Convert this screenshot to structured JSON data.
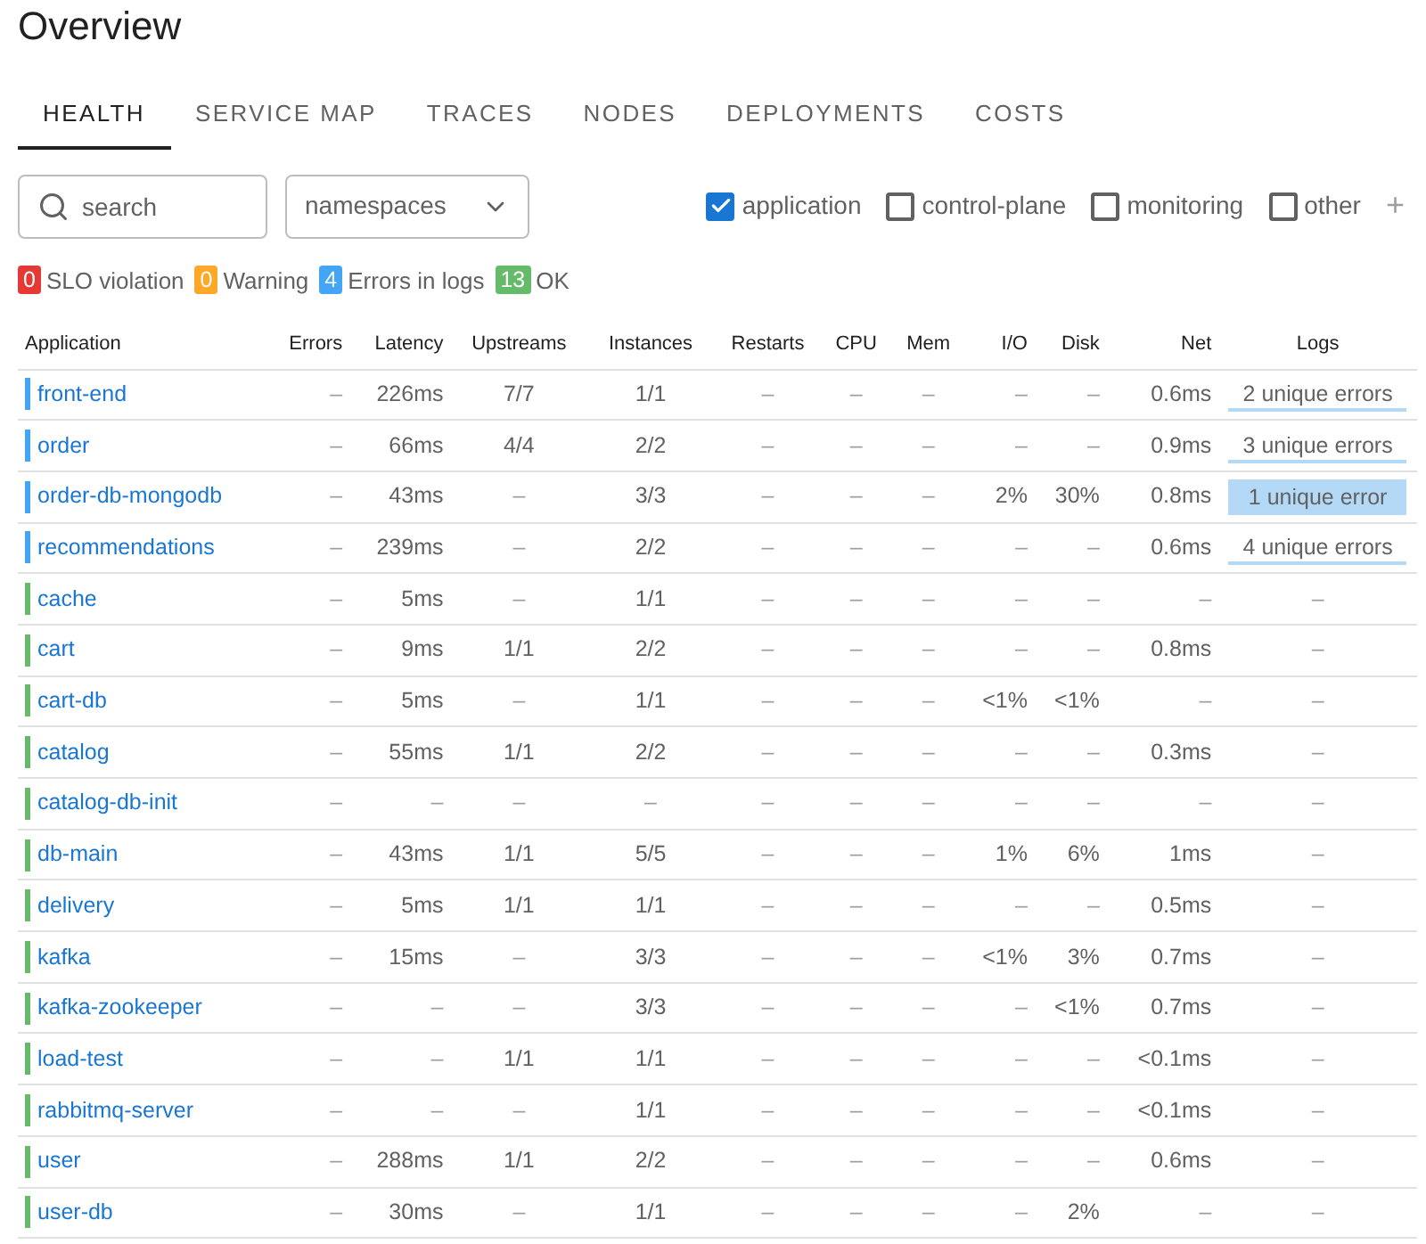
{
  "page_title": "Overview",
  "tabs": [
    {
      "label": "HEALTH",
      "selected": true
    },
    {
      "label": "SERVICE MAP",
      "selected": false
    },
    {
      "label": "TRACES",
      "selected": false
    },
    {
      "label": "NODES",
      "selected": false
    },
    {
      "label": "DEPLOYMENTS",
      "selected": false
    },
    {
      "label": "COSTS",
      "selected": false
    }
  ],
  "search": {
    "placeholder": "search"
  },
  "namespaces": {
    "placeholder": "namespaces"
  },
  "filters": [
    {
      "label": "application",
      "checked": true
    },
    {
      "label": "control-plane",
      "checked": false
    },
    {
      "label": "monitoring",
      "checked": false
    },
    {
      "label": "other",
      "checked": false
    }
  ],
  "add_filter": "+",
  "summary": [
    {
      "count": "0",
      "label": "SLO violation",
      "color": "#e53935"
    },
    {
      "count": "0",
      "label": "Warning",
      "color": "#ffa726"
    },
    {
      "count": "4",
      "label": "Errors in logs",
      "color": "#42a5f5"
    },
    {
      "count": "13",
      "label": "OK",
      "color": "#66bb6a"
    }
  ],
  "table": {
    "columns": [
      "Application",
      "Errors",
      "Latency",
      "Upstreams",
      "Instances",
      "Restarts",
      "CPU",
      "Mem",
      "I/O",
      "Disk",
      "Net",
      "Logs"
    ],
    "rows": [
      {
        "color": "#42a5f5",
        "cells": [
          "front-end",
          "–",
          "226ms",
          "7/7",
          "1/1",
          "–",
          "–",
          "–",
          "–",
          "–",
          "0.6ms"
        ],
        "logs": {
          "text": "2 unique errors",
          "kind": "errors",
          "highlighted": false
        }
      },
      {
        "color": "#42a5f5",
        "cells": [
          "order",
          "–",
          "66ms",
          "4/4",
          "2/2",
          "–",
          "–",
          "–",
          "–",
          "–",
          "0.9ms"
        ],
        "logs": {
          "text": "3 unique errors",
          "kind": "errors",
          "highlighted": false
        }
      },
      {
        "color": "#42a5f5",
        "cells": [
          "order-db-mongodb",
          "–",
          "43ms",
          "–",
          "3/3",
          "–",
          "–",
          "–",
          "2%",
          "30%",
          "0.8ms"
        ],
        "logs": {
          "text": "1 unique error",
          "kind": "errors",
          "highlighted": true
        }
      },
      {
        "color": "#42a5f5",
        "cells": [
          "recommendations",
          "–",
          "239ms",
          "–",
          "2/2",
          "–",
          "–",
          "–",
          "–",
          "–",
          "0.6ms"
        ],
        "logs": {
          "text": "4 unique errors",
          "kind": "errors",
          "highlighted": false
        }
      },
      {
        "color": "#66bb6a",
        "cells": [
          "cache",
          "–",
          "5ms",
          "–",
          "1/1",
          "–",
          "–",
          "–",
          "–",
          "–",
          "–"
        ],
        "logs": {
          "text": "–",
          "kind": "none"
        }
      },
      {
        "color": "#66bb6a",
        "cells": [
          "cart",
          "–",
          "9ms",
          "1/1",
          "2/2",
          "–",
          "–",
          "–",
          "–",
          "–",
          "0.8ms"
        ],
        "logs": {
          "text": "–",
          "kind": "none"
        }
      },
      {
        "color": "#66bb6a",
        "cells": [
          "cart-db",
          "–",
          "5ms",
          "–",
          "1/1",
          "–",
          "–",
          "–",
          "<1%",
          "<1%",
          "–"
        ],
        "logs": {
          "text": "–",
          "kind": "none"
        }
      },
      {
        "color": "#66bb6a",
        "cells": [
          "catalog",
          "–",
          "55ms",
          "1/1",
          "2/2",
          "–",
          "–",
          "–",
          "–",
          "–",
          "0.3ms"
        ],
        "logs": {
          "text": "–",
          "kind": "none"
        }
      },
      {
        "color": "#66bb6a",
        "cells": [
          "catalog-db-init",
          "–",
          "–",
          "–",
          "–",
          "–",
          "–",
          "–",
          "–",
          "–",
          "–"
        ],
        "logs": {
          "text": "–",
          "kind": "none"
        }
      },
      {
        "color": "#66bb6a",
        "cells": [
          "db-main",
          "–",
          "43ms",
          "1/1",
          "5/5",
          "–",
          "–",
          "–",
          "1%",
          "6%",
          "1ms"
        ],
        "logs": {
          "text": "–",
          "kind": "none"
        }
      },
      {
        "color": "#66bb6a",
        "cells": [
          "delivery",
          "–",
          "5ms",
          "1/1",
          "1/1",
          "–",
          "–",
          "–",
          "–",
          "–",
          "0.5ms"
        ],
        "logs": {
          "text": "–",
          "kind": "none"
        }
      },
      {
        "color": "#66bb6a",
        "cells": [
          "kafka",
          "–",
          "15ms",
          "–",
          "3/3",
          "–",
          "–",
          "–",
          "<1%",
          "3%",
          "0.7ms"
        ],
        "logs": {
          "text": "–",
          "kind": "none"
        }
      },
      {
        "color": "#66bb6a",
        "cells": [
          "kafka-zookeeper",
          "–",
          "–",
          "–",
          "3/3",
          "–",
          "–",
          "–",
          "–",
          "<1%",
          "0.7ms"
        ],
        "logs": {
          "text": "–",
          "kind": "none"
        }
      },
      {
        "color": "#66bb6a",
        "cells": [
          "load-test",
          "–",
          "–",
          "1/1",
          "1/1",
          "–",
          "–",
          "–",
          "–",
          "–",
          "<0.1ms"
        ],
        "logs": {
          "text": "–",
          "kind": "none"
        }
      },
      {
        "color": "#66bb6a",
        "cells": [
          "rabbitmq-server",
          "–",
          "–",
          "–",
          "1/1",
          "–",
          "–",
          "–",
          "–",
          "–",
          "<0.1ms"
        ],
        "logs": {
          "text": "–",
          "kind": "none"
        }
      },
      {
        "color": "#66bb6a",
        "cells": [
          "user",
          "–",
          "288ms",
          "1/1",
          "2/2",
          "–",
          "–",
          "–",
          "–",
          "–",
          "0.6ms"
        ],
        "logs": {
          "text": "–",
          "kind": "none"
        }
      },
      {
        "color": "#66bb6a",
        "cells": [
          "user-db",
          "–",
          "30ms",
          "–",
          "1/1",
          "–",
          "–",
          "–",
          "–",
          "2%",
          "–"
        ],
        "logs": {
          "text": "–",
          "kind": "none"
        }
      }
    ]
  }
}
